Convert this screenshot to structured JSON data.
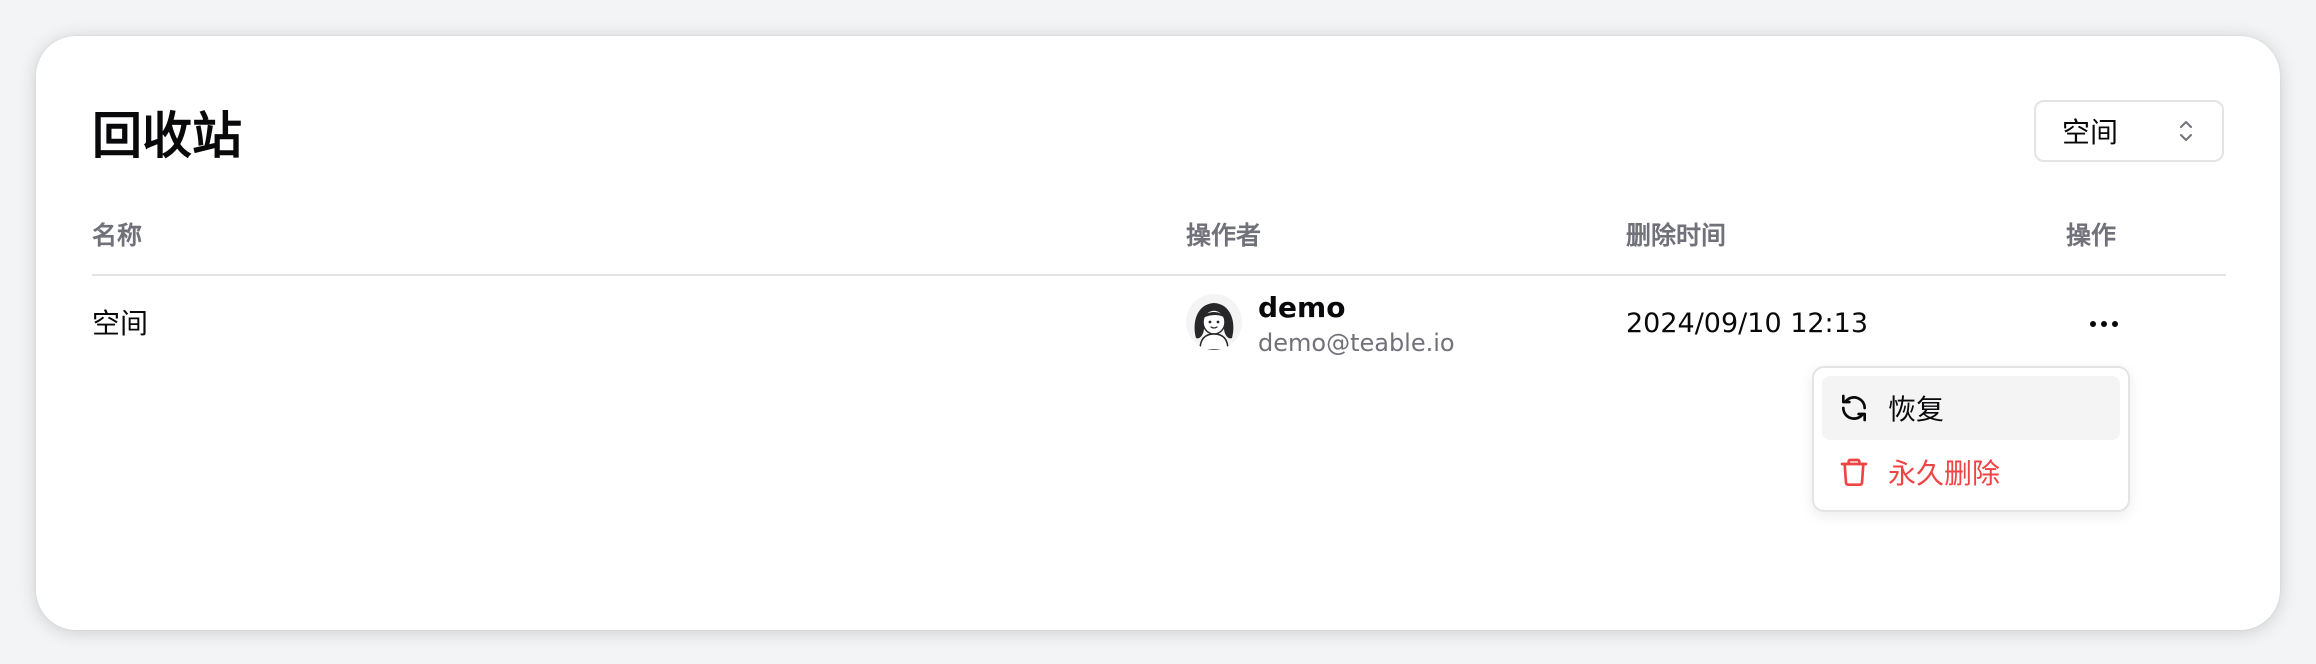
{
  "page": {
    "title": "回收站"
  },
  "filter": {
    "selected": "空间",
    "icon": "chevron-up-down-icon"
  },
  "table": {
    "columns": {
      "name": "名称",
      "operator": "操作者",
      "deleted_time": "删除时间",
      "actions": "操作"
    },
    "rows": [
      {
        "name": "空间",
        "operator_name": "demo",
        "operator_email": "demo@teable.io",
        "deleted_time": "2024/09/10 12:13"
      }
    ]
  },
  "context_menu": {
    "items": [
      {
        "label": "恢复",
        "icon": "refresh-icon"
      },
      {
        "label": "永久删除",
        "icon": "trash-icon",
        "color": "#ef4444"
      }
    ]
  },
  "colors": {
    "accent_danger": "#ef4444",
    "muted_text": "#71717a",
    "border": "#e4e4e7"
  }
}
